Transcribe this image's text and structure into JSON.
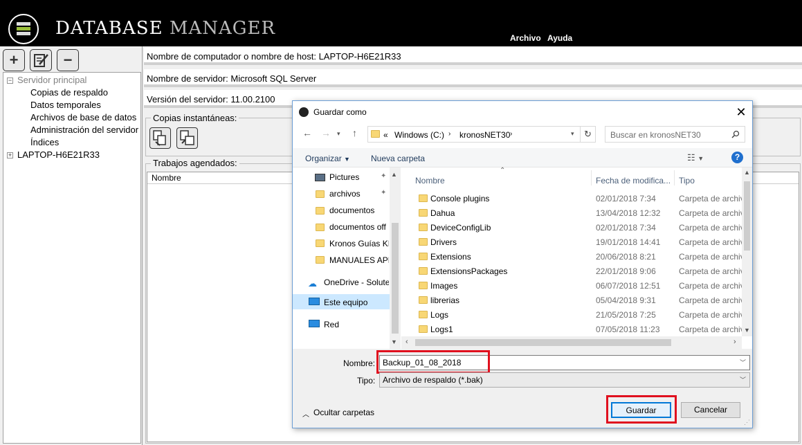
{
  "app": {
    "title_part1": "DATABASE",
    "title_part2": "MANAGER",
    "menu": [
      "Archivo",
      "Ayuda"
    ]
  },
  "tree": {
    "root": "Servidor principal",
    "children": [
      "Copias de respaldo",
      "Datos temporales",
      "Archivos de base de datos",
      "Administración del servidor",
      "Índices"
    ],
    "host": "LAPTOP-H6E21R33"
  },
  "info": {
    "host": "Nombre de computador o nombre de host: LAPTOP-H6E21R33",
    "server": "Nombre de servidor: Microsoft SQL Server",
    "version": "Versión del servidor: 11.00.2100"
  },
  "groups": {
    "snapshots": "Copias instantáneas:",
    "jobs": "Trabajos agendados:",
    "jobs_col": "Nombre"
  },
  "dialog": {
    "title": "Guardar como",
    "address": [
      "Windows (C:)",
      "kronosNET30"
    ],
    "address_prefix": "«",
    "search_placeholder": "Buscar en kronosNET30",
    "organize": "Organizar",
    "new_folder": "Nueva carpeta",
    "nav_items": [
      "Pictures",
      "archivos",
      "documentos",
      "documentos off",
      "Kronos Guías KN",
      "MANUALES APP",
      "OneDrive - Solute",
      "Este equipo",
      "Red"
    ],
    "columns": [
      "Nombre",
      "Fecha de modifica...",
      "Tipo"
    ],
    "files": [
      {
        "name": "Console plugins",
        "date": "02/01/2018 7:34",
        "type": "Carpeta de archiv"
      },
      {
        "name": "Dahua",
        "date": "13/04/2018 12:32",
        "type": "Carpeta de archiv"
      },
      {
        "name": "DeviceConfigLib",
        "date": "02/01/2018 7:34",
        "type": "Carpeta de archiv"
      },
      {
        "name": "Drivers",
        "date": "19/01/2018 14:41",
        "type": "Carpeta de archiv"
      },
      {
        "name": "Extensions",
        "date": "20/06/2018 8:21",
        "type": "Carpeta de archiv"
      },
      {
        "name": "ExtensionsPackages",
        "date": "22/01/2018 9:06",
        "type": "Carpeta de archiv"
      },
      {
        "name": "Images",
        "date": "06/07/2018 12:51",
        "type": "Carpeta de archiv"
      },
      {
        "name": "librerias",
        "date": "05/04/2018 9:31",
        "type": "Carpeta de archiv"
      },
      {
        "name": "Logs",
        "date": "21/05/2018 7:25",
        "type": "Carpeta de archiv"
      },
      {
        "name": "Logs1",
        "date": "07/05/2018 11:23",
        "type": "Carpeta de archiv"
      }
    ],
    "name_label": "Nombre:",
    "name_value": "Backup_01_08_2018",
    "type_label": "Tipo:",
    "type_value": "Archivo de respaldo (*.bak)",
    "hide_folders": "Ocultar carpetas",
    "save": "Guardar",
    "cancel": "Cancelar"
  },
  "colors": {
    "highlight": "#e0101e",
    "selected_nav": "#cce8ff"
  }
}
